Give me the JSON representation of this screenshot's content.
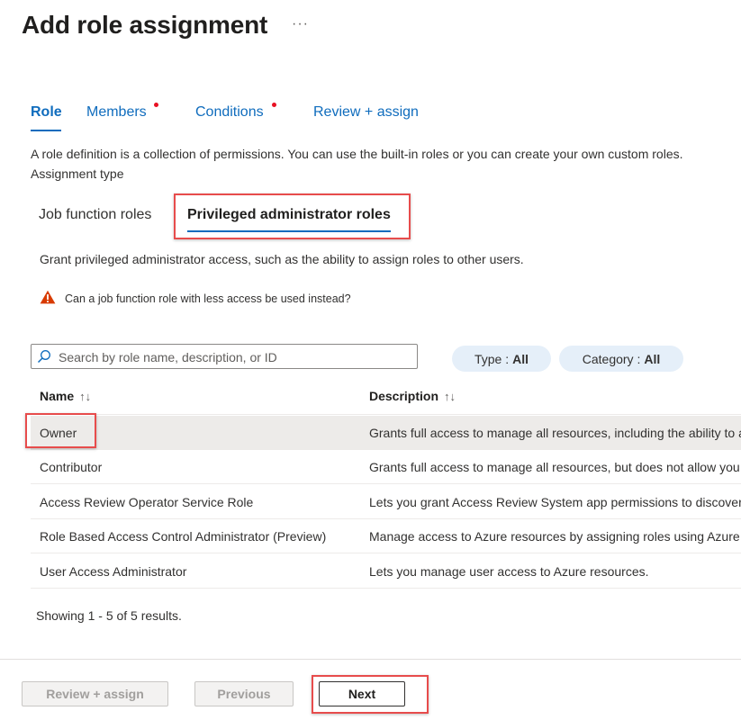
{
  "header": {
    "title": "Add role assignment",
    "more": "···"
  },
  "tabs": [
    {
      "label": "Role",
      "active": true
    },
    {
      "label": "Members",
      "required": true
    },
    {
      "label": "Conditions",
      "required": true
    },
    {
      "label": "Review + assign"
    }
  ],
  "description": "A role definition is a collection of permissions. You can use the built-in roles or you can create your own custom roles.",
  "assignment_type_label": "Assignment type",
  "subtabs": [
    {
      "label": "Job function roles"
    },
    {
      "label": "Privileged administrator roles",
      "active": true
    }
  ],
  "grant_text": "Grant privileged administrator access, such as the ability to assign roles to other users.",
  "warning_text": "Can a job function role with less access be used instead?",
  "search": {
    "placeholder": "Search by role name, description, or ID",
    "value": ""
  },
  "filters": [
    {
      "label": "Type :",
      "value": "All"
    },
    {
      "label": "Category :",
      "value": "All"
    }
  ],
  "table": {
    "columns": [
      {
        "label": "Name",
        "sort": "↑↓"
      },
      {
        "label": "Description",
        "sort": "↑↓"
      }
    ],
    "rows": [
      {
        "name": "Owner",
        "description": "Grants full access to manage all resources, including the ability to assign roles in Azure RBAC."
      },
      {
        "name": "Contributor",
        "description": "Grants full access to manage all resources, but does not allow you to assign roles in Azure RBAC."
      },
      {
        "name": "Access Review Operator Service Role",
        "description": "Lets you grant Access Review System app permissions to discover and revoke access."
      },
      {
        "name": "Role Based Access Control Administrator (Preview)",
        "description": "Manage access to Azure resources by assigning roles using Azure RBAC."
      },
      {
        "name": "User Access Administrator",
        "description": "Lets you manage user access to Azure resources."
      }
    ]
  },
  "showing_text": "Showing 1 - 5 of 5 results.",
  "footer": {
    "review_label": "Review + assign",
    "previous_label": "Previous",
    "next_label": "Next"
  },
  "colors": {
    "accent": "#0f6cbd",
    "required_dot": "#e81123",
    "highlight": "#e74c4c",
    "warning": "#d83b01"
  }
}
